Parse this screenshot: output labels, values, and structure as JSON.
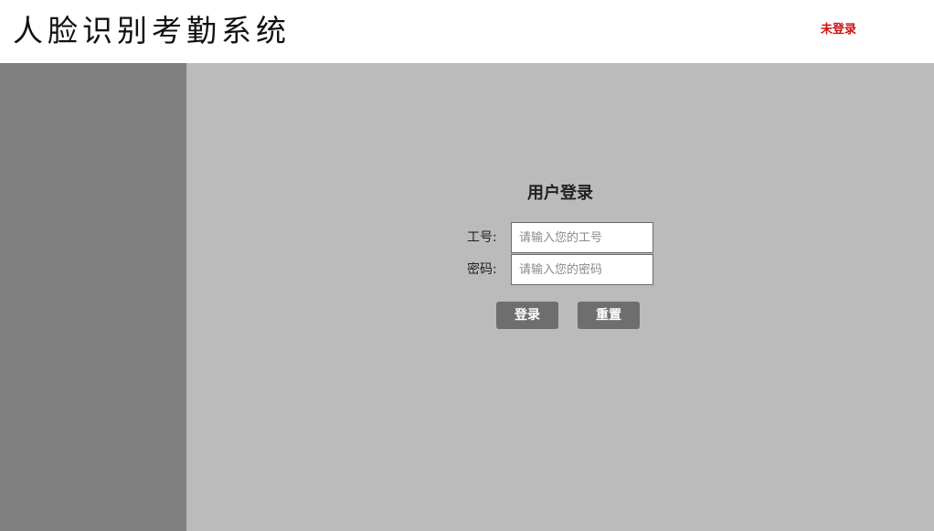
{
  "header": {
    "app_title": "人脸识别考勤系统",
    "login_status": "未登录"
  },
  "login_form": {
    "title": "用户登录",
    "employee_id": {
      "label": "工号:",
      "placeholder": "请输入您的工号",
      "value": ""
    },
    "password": {
      "label": "密码:",
      "placeholder": "请输入您的密码",
      "value": ""
    },
    "login_button": "登录",
    "reset_button": "重置"
  }
}
